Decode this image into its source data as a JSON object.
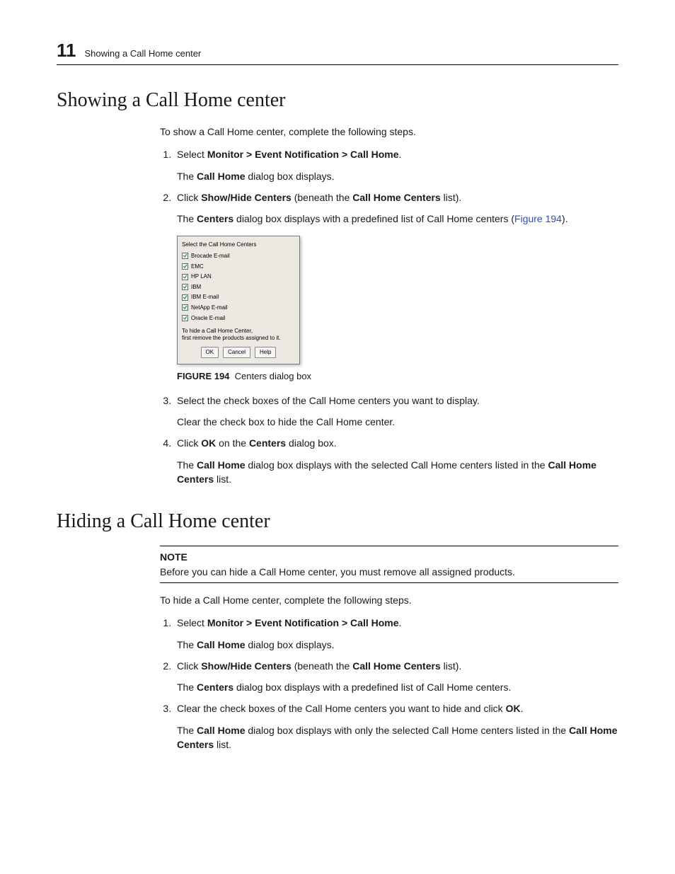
{
  "header": {
    "chapter_number": "11",
    "running_title": "Showing a Call Home center"
  },
  "section1": {
    "title": "Showing a Call Home center",
    "intro": "To show a Call Home center, complete the following steps.",
    "step1_select": "Select ",
    "step1_path": "Monitor > Event Notification > Call Home",
    "step1_result_pre": "The ",
    "step1_result_b": "Call Home",
    "step1_result_post": " dialog box displays.",
    "step2_click": "Click ",
    "step2_b1": "Show/Hide Centers",
    "step2_mid": " (beneath the ",
    "step2_b2": "Call Home Centers",
    "step2_end": " list).",
    "step2_result_pre": "The ",
    "step2_result_b": "Centers",
    "step2_result_mid": " dialog box displays with a predefined list of Call Home centers (",
    "step2_result_link": "Figure 194",
    "step2_result_end": ")."
  },
  "dialog": {
    "caption": "Select the Call Home Centers",
    "items": [
      "Brocade E-mail",
      "EMC",
      "HP LAN",
      "IBM",
      "IBM E-mail",
      "NetApp E-mail",
      "Oracle E-mail"
    ],
    "note_l1": "To hide a Call Home Center,",
    "note_l2": "first remove the products assigned to it.",
    "ok": "OK",
    "cancel": "Cancel",
    "help": "Help"
  },
  "figure": {
    "num": "FIGURE 194",
    "caption": "Centers dialog box"
  },
  "section1b": {
    "step3": "Select the check boxes of the Call Home centers you want to display.",
    "step3_result": "Clear the check box to hide the Call Home center.",
    "step4_click": "Click ",
    "step4_b1": "OK",
    "step4_mid": " on the ",
    "step4_b2": "Centers",
    "step4_end": " dialog box.",
    "step4_res_pre": "The ",
    "step4_res_b1": "Call Home",
    "step4_res_mid": " dialog box displays with the selected Call Home centers listed in the ",
    "step4_res_b2": "Call Home Centers",
    "step4_res_end": " list."
  },
  "section2": {
    "title": "Hiding a Call Home center",
    "note_label": "NOTE",
    "note_text": "Before you can hide a Call Home center, you must remove all assigned products.",
    "intro": "To hide a Call Home center, complete the following steps.",
    "step1_select": "Select ",
    "step1_path": "Monitor > Event Notification > Call Home",
    "step1_result_pre": "The ",
    "step1_result_b": "Call Home",
    "step1_result_post": " dialog box displays.",
    "step2_click": "Click ",
    "step2_b1": "Show/Hide Centers",
    "step2_mid": " (beneath the ",
    "step2_b2": "Call Home Centers",
    "step2_end": " list).",
    "step2_res_pre": "The ",
    "step2_res_b": "Centers",
    "step2_res_end": " dialog box displays with a predefined list of Call Home centers.",
    "step3_pre": "Clear the check boxes of the Call Home centers you want to hide and click ",
    "step3_b": "OK",
    "step3_end": ".",
    "step3_res_pre": "The ",
    "step3_res_b1": "Call Home",
    "step3_res_mid": " dialog box displays with only the selected Call Home centers listed in the ",
    "step3_res_b2": "Call Home Centers",
    "step3_res_end": " list."
  }
}
